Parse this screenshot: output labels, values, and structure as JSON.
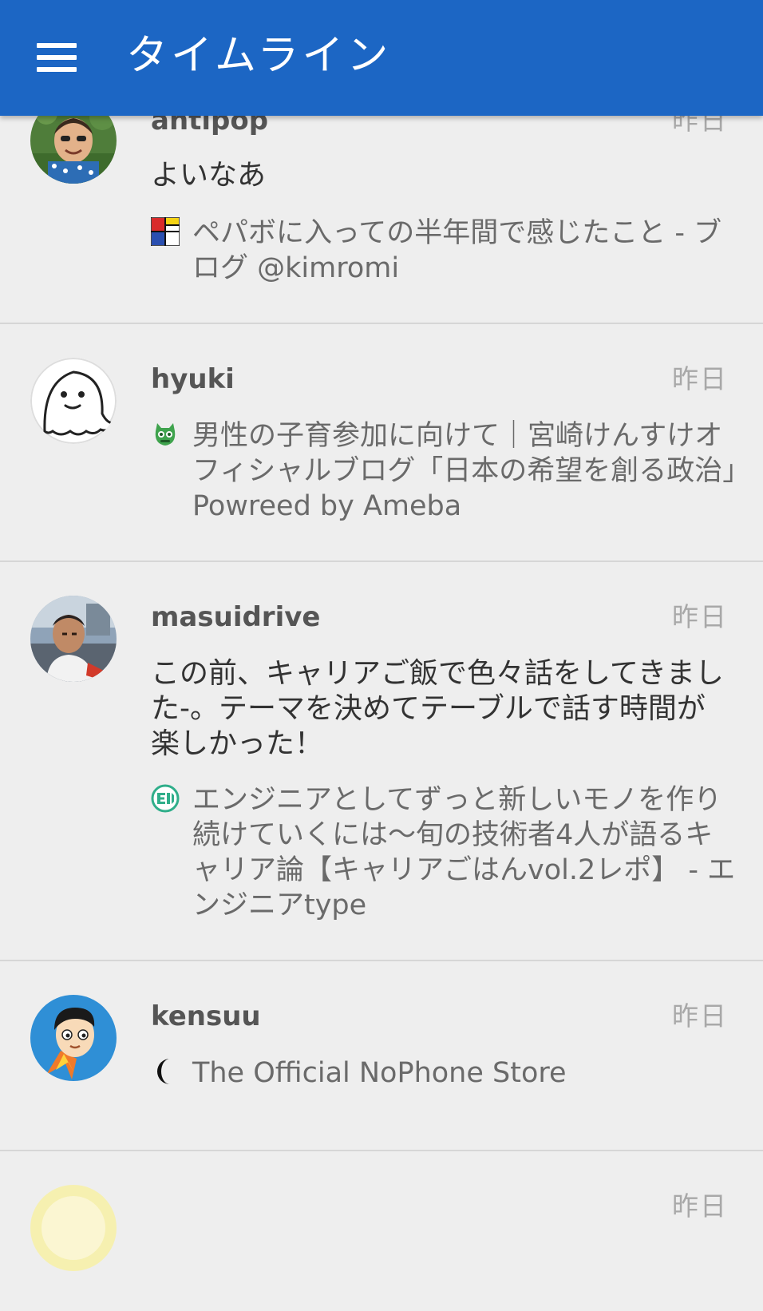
{
  "appbar": {
    "title": "タイムライン",
    "menu_icon": "hamburger-menu-icon",
    "color": "#1c66c4"
  },
  "entries": [
    {
      "user": "antipop",
      "time": "昨日",
      "comment": "よいなあ",
      "link_title": "ペパボに入っての半年間で感じたこと - ブログ @kimromi",
      "favicon": "mondrian-favicon-icon"
    },
    {
      "user": "hyuki",
      "time": "昨日",
      "comment": "",
      "link_title": "男性の子育参加に向けて｜宮崎けんすけオフィシャルブログ「日本の希望を創る政治」Powreed by Ameba",
      "favicon": "ameba-favicon-icon"
    },
    {
      "user": "masuidrive",
      "time": "昨日",
      "comment": "この前、キャリアご飯で色々話をしてきました-。テーマを決めてテーブルで話す時間が楽しかった！",
      "link_title": "エンジニアとしてずっと新しいモノを作り続けていくには〜旬の技術者4人が語るキャリア論【キャリアごはんvol.2レポ】 - エンジニアtype",
      "favicon": "engineer-type-favicon-icon"
    },
    {
      "user": "kensuu",
      "time": "昨日",
      "comment": "",
      "link_title": "The Official NoPhone Store",
      "favicon": "nophone-favicon-icon"
    },
    {
      "user": "",
      "time": "昨日",
      "comment": "",
      "link_title": "",
      "favicon": ""
    }
  ],
  "colors": {
    "background": "#eeeeee",
    "divider": "#d6d6d6",
    "username": "#555555",
    "time": "#a8a8a8"
  }
}
